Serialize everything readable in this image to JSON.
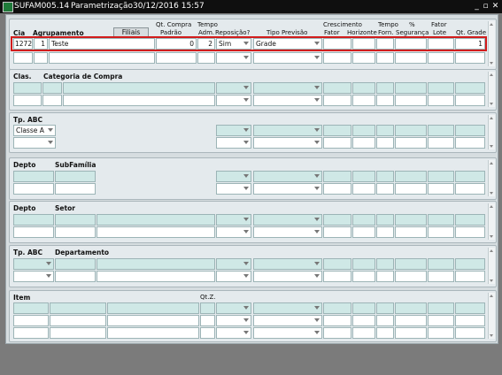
{
  "window": {
    "code": "SUFAM005.14",
    "title": "Parametrização",
    "datetime": "30/12/2016 15:57",
    "buttons": {
      "minimize": "_",
      "maximize": "▫",
      "close": "✕"
    }
  },
  "top": {
    "headers": {
      "cia": "Cia",
      "agrupamento": "Agrupamento",
      "filiais": "Filiais",
      "qt_compra": "Qt. Compra",
      "padrao": "Padrão",
      "tempo": "Tempo",
      "adm": "Adm.",
      "reposicao": "Reposição?",
      "tipo_previsao": "Tipo Previsão",
      "crescimento": "Crescimento",
      "fator": "Fator",
      "horizonte": "Horizonte",
      "tempo_forn_top": "Tempo",
      "forn": "Forn.",
      "pct": "%",
      "seguranca": "Segurança",
      "fator_lote_top": "Fator",
      "lote": "Lote",
      "qt_grade": "Qt. Grade"
    },
    "row": {
      "cia": "1272",
      "agrup_num": "1",
      "agrup_nome": "Teste",
      "qt_compra": "0",
      "tempo_adm": "2",
      "reposicao": "Sim",
      "tipo_previsao": "Grade",
      "qt_grade": "1"
    }
  },
  "blocks": {
    "clas": {
      "label1": "Clas.",
      "label2": "Categoria de Compra"
    },
    "tpabc": {
      "label1": "Tp. ABC",
      "value": "Classe A"
    },
    "depto_sub": {
      "label1": "Depto",
      "label2": "SubFamília"
    },
    "depto_setor": {
      "label1": "Depto",
      "label2": "Setor"
    },
    "tpabc_dep": {
      "label1": "Tp. ABC",
      "label2": "Departamento"
    },
    "item": {
      "label1": "Item",
      "label2": "Qt.Z."
    }
  }
}
